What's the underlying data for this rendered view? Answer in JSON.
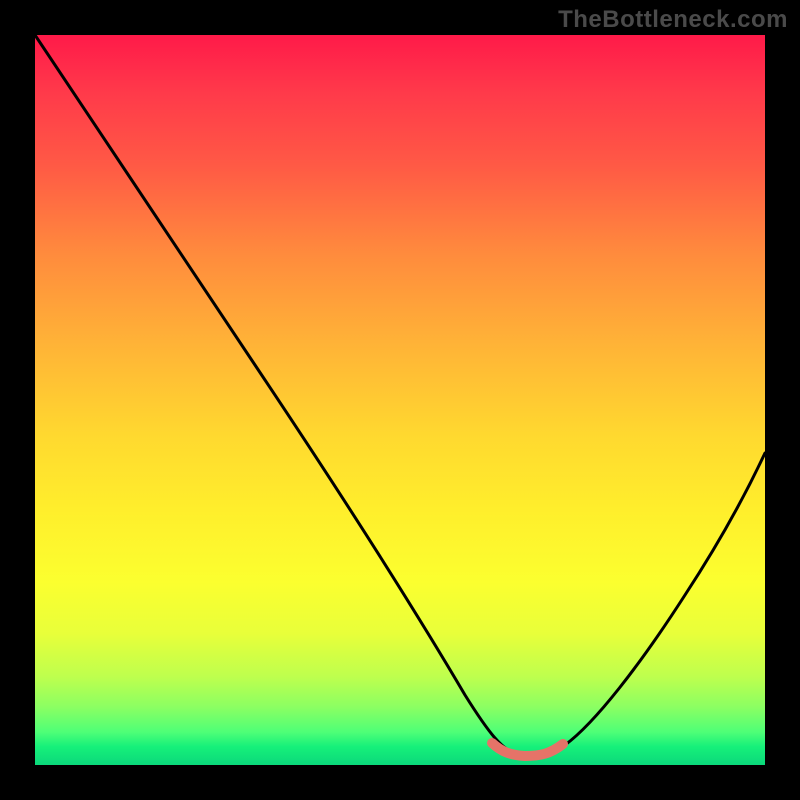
{
  "watermark": "TheBottleneck.com",
  "chart_data": {
    "type": "line",
    "title": "",
    "xlabel": "",
    "ylabel": "",
    "xlim": [
      0,
      100
    ],
    "ylim": [
      0,
      100
    ],
    "gradient_bands": [
      {
        "name": "red",
        "approx_pct_from_top": 0
      },
      {
        "name": "orange",
        "approx_pct_from_top": 40
      },
      {
        "name": "yellow",
        "approx_pct_from_top": 65
      },
      {
        "name": "green",
        "approx_pct_from_top": 97
      }
    ],
    "series": [
      {
        "name": "black-curve",
        "color": "#000000",
        "points_xy_pct": [
          [
            0,
            100
          ],
          [
            10,
            85
          ],
          [
            20,
            70
          ],
          [
            30,
            55
          ],
          [
            40,
            40
          ],
          [
            50,
            25
          ],
          [
            57,
            12
          ],
          [
            62,
            4
          ],
          [
            65,
            1.5
          ],
          [
            68,
            1.5
          ],
          [
            71,
            1.5
          ],
          [
            74,
            4
          ],
          [
            80,
            14
          ],
          [
            88,
            28
          ],
          [
            95,
            40
          ],
          [
            100,
            48
          ]
        ]
      },
      {
        "name": "salmon-flat-segment",
        "color": "#e57368",
        "points_xy_pct": [
          [
            63,
            2.2
          ],
          [
            65,
            1.6
          ],
          [
            68,
            1.5
          ],
          [
            71,
            1.6
          ],
          [
            73,
            2.2
          ]
        ]
      }
    ],
    "notes": "Percentages are relative to the gradient plot area. y=0 is the bottom (green), y=100 is the top (red). The salmon segment traces the shallow trough of the black curve near x≈63–73%."
  }
}
